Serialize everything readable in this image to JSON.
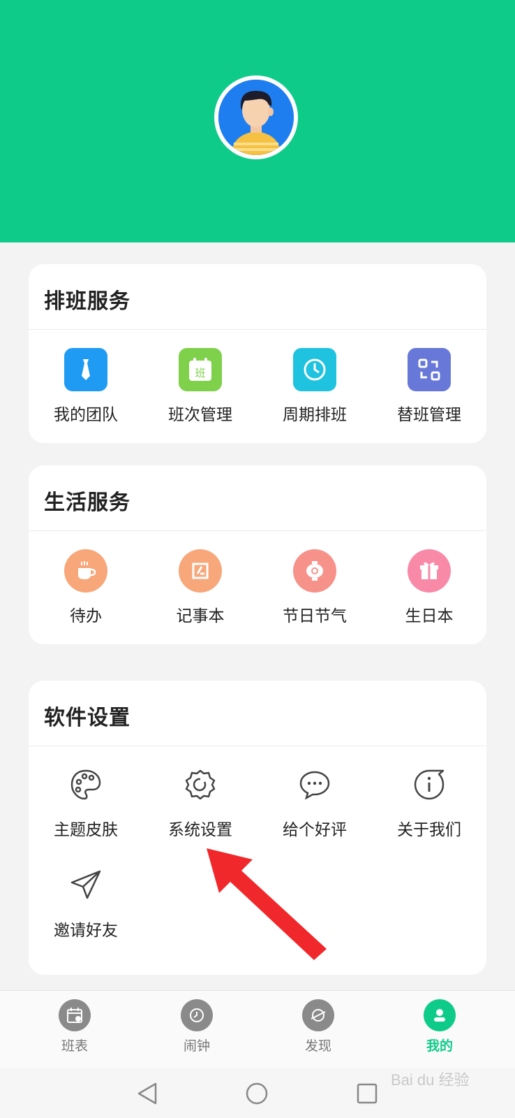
{
  "header": {
    "avatar": "user-avatar"
  },
  "sections": [
    {
      "title": "排班服务",
      "items": [
        {
          "label": "我的团队",
          "icon": "tie-icon",
          "color": "#1f9bf3"
        },
        {
          "label": "班次管理",
          "icon": "calendar-icon",
          "color": "#7fd04a",
          "icon_text": "班"
        },
        {
          "label": "周期排班",
          "icon": "clock-cycle-icon",
          "color": "#1fc3e0"
        },
        {
          "label": "替班管理",
          "icon": "swap-icon",
          "color": "#6878d8"
        }
      ]
    },
    {
      "title": "生活服务",
      "items": [
        {
          "label": "待办",
          "icon": "coffee-cup-icon",
          "color": "#f7a77a"
        },
        {
          "label": "记事本",
          "icon": "notebook-icon",
          "color": "#f7a77a"
        },
        {
          "label": "节日节气",
          "icon": "lantern-icon",
          "color": "#f7928b"
        },
        {
          "label": "生日本",
          "icon": "gift-icon",
          "color": "#f88aa8"
        }
      ]
    },
    {
      "title": "软件设置",
      "items": [
        {
          "label": "主题皮肤",
          "icon": "palette-icon"
        },
        {
          "label": "系统设置",
          "icon": "gear-icon"
        },
        {
          "label": "给个好评",
          "icon": "chat-bubble-icon"
        },
        {
          "label": "关于我们",
          "icon": "info-icon"
        },
        {
          "label": "邀请好友",
          "icon": "paper-plane-icon"
        }
      ]
    }
  ],
  "tabs": [
    {
      "label": "班表",
      "icon": "schedule-icon",
      "active": false
    },
    {
      "label": "闹钟",
      "icon": "alarm-icon",
      "active": false
    },
    {
      "label": "发现",
      "icon": "discover-icon",
      "active": false
    },
    {
      "label": "我的",
      "icon": "profile-icon",
      "active": true
    }
  ],
  "annotation": {
    "type": "red-arrow",
    "target": "系统设置"
  },
  "watermark": "Bai du 经验"
}
